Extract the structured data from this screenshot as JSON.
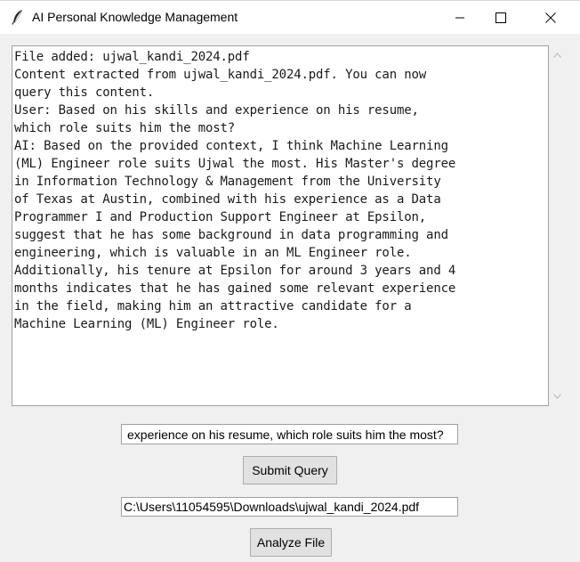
{
  "window": {
    "title": "AI Personal Knowledge Management",
    "icon": "feather-icon"
  },
  "output": {
    "lines": [
      "File added: ujwal_kandi_2024.pdf",
      "Content extracted from ujwal_kandi_2024.pdf. You can now",
      "query this content.",
      "User: Based on his skills and experience on his resume,",
      "which role suits him the most?",
      "AI: Based on the provided context, I think Machine Learning",
      "(ML) Engineer role suits Ujwal the most. His Master's degree",
      "in Information Technology & Management from the University",
      "of Texas at Austin, combined with his experience as a Data",
      "Programmer I and Production Support Engineer at Epsilon,",
      "suggest that he has some background in data programming and",
      "engineering, which is valuable in an ML Engineer role.",
      "Additionally, his tenure at Epsilon for around 3 years and 4",
      "months indicates that he has gained some relevant experience",
      "in the field, making him an attractive candidate for a",
      "Machine Learning (ML) Engineer role."
    ]
  },
  "query": {
    "value": "experience on his resume, which role suits him the most?"
  },
  "buttons": {
    "submit_label": "Submit Query",
    "analyze_label": "Analyze File"
  },
  "file": {
    "path": "C:\\Users\\11054595\\Downloads\\ujwal_kandi_2024.pdf"
  }
}
